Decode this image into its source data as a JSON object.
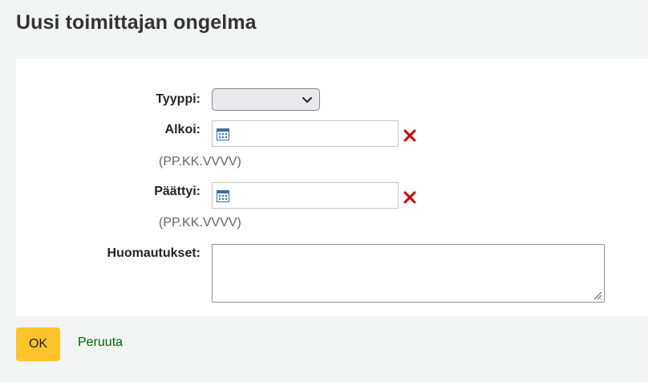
{
  "page": {
    "title": "Uusi toimittajan ongelma"
  },
  "form": {
    "type": {
      "label": "Tyyppi:",
      "value": ""
    },
    "started": {
      "label": "Alkoi:",
      "value": "",
      "hint": "(PP.KK.VVVV)"
    },
    "ended": {
      "label": "Päättyi:",
      "value": "",
      "hint": "(PP.KK.VVVV)"
    },
    "notes": {
      "label": "Huomautukset:",
      "value": ""
    }
  },
  "actions": {
    "ok_label": "OK",
    "cancel_label": "Peruuta"
  },
  "colors": {
    "ok_button": "#ffc32b",
    "cancel_link": "#006100",
    "clear_icon": "#cc0000",
    "calendar_icon": "#3a6ea5",
    "background": "#f3f4f4",
    "panel": "#ffffff"
  },
  "icons": {
    "select": "chevron-down-icon",
    "date": "calendar-icon",
    "clear": "clear-x-icon",
    "textarea": "resize-grip-icon"
  }
}
